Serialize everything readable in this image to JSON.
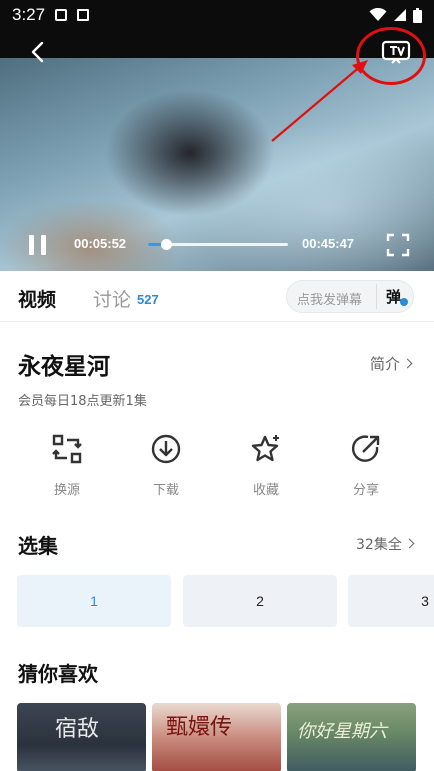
{
  "status_bar": {
    "time": "3:27"
  },
  "player": {
    "current_time": "00:05:52",
    "total_time": "00:45:47",
    "progress_fraction": 0.128
  },
  "tabs": {
    "video": "视频",
    "discuss": "讨论",
    "discuss_count": "527",
    "danmu_placeholder": "点我发弹幕",
    "danmu_button": "弹"
  },
  "show": {
    "title": "永夜星河",
    "intro_label": "简介",
    "subtitle": "会员每日18点更新1集"
  },
  "actions": [
    {
      "label": "换源",
      "icon": "swap-source-icon"
    },
    {
      "label": "下载",
      "icon": "download-icon"
    },
    {
      "label": "收藏",
      "icon": "star-icon"
    },
    {
      "label": "分享",
      "icon": "share-icon"
    }
  ],
  "episodes": {
    "title": "选集",
    "all_label": "32集全",
    "items": [
      "1",
      "2",
      "3"
    ],
    "active": "1"
  },
  "recommend": {
    "title": "猜你喜欢",
    "items": [
      {
        "poster_text": "宿敌"
      },
      {
        "poster_text": "甄嬛传"
      },
      {
        "poster_text": "你好星期六"
      }
    ]
  },
  "colors": {
    "accent": "#2a8bd8",
    "highlight_circle": "#e01010"
  }
}
